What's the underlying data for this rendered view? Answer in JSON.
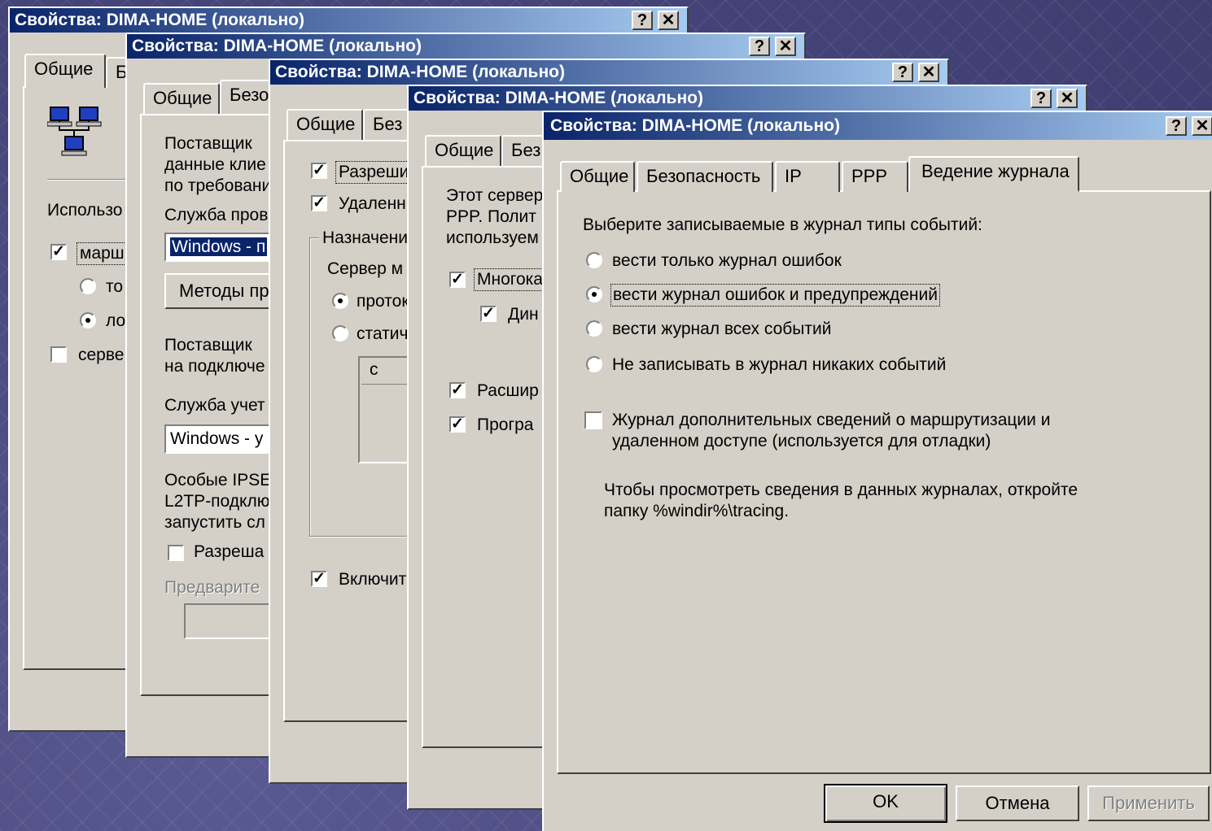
{
  "window_title": "Свойства: DIMA-HOME (локально)",
  "help_glyph": "?",
  "close_glyph": "✕",
  "check_glyph": "✓",
  "win1": {
    "tabs": [
      "Общие",
      "Б"
    ],
    "labels": [
      "Использо",
      "марш",
      "то",
      "ло",
      "серве"
    ]
  },
  "win2": {
    "tabs": [
      "Общие",
      "Безо"
    ],
    "lines": [
      "Поставщик",
      "данные клие",
      "по требовани",
      "Служба пров"
    ],
    "select_value": "Windows - п",
    "methods_button": "Методы пр",
    "lines2": [
      "Поставщик",
      "на подключе"
    ],
    "accounting_label": "Служба учет",
    "accounting_value": "Windows - у",
    "ipsec_lines": [
      "Особые IPSE",
      "L2TP-подклю",
      "запустить сл"
    ],
    "allow_label": "Разреша",
    "preshared_label": "Предварите"
  },
  "win3": {
    "tabs": [
      "Общие",
      "Без"
    ],
    "items": [
      "Разреши",
      "Удаленн"
    ],
    "group_label": "Назначени",
    "server_label": "Сервер м",
    "radio_items": [
      "проток",
      "статич"
    ],
    "list_header": "с",
    "enable_label": "Включит"
  },
  "win4": {
    "tabs": [
      "Общие",
      "Без"
    ],
    "lines": [
      "Этот сервер",
      "PPP. Полит",
      "используем"
    ],
    "items": [
      "Многока",
      "Дин",
      "Расшир",
      "Програ"
    ]
  },
  "win5": {
    "tabs": [
      "Общие",
      "Безопасность",
      "IP",
      "PPP",
      "Ведение журнала"
    ],
    "prompt": "Выберите записываемые в журнал типы событий:",
    "options": [
      "вести только журнал ошибок",
      "вести журнал ошибок и предупреждений",
      "вести журнал всех событий",
      "Не записывать в журнал никаких событий"
    ],
    "selected_option": 1,
    "extra_log_line1": "Журнал дополнительных сведений о маршрутизации и",
    "extra_log_line2": "удаленном доступе (используется для отладки)",
    "info_line1": "Чтобы просмотреть сведения в данных журналах, откройте",
    "info_line2": "папку %windir%\\tracing.",
    "buttons": {
      "ok": "OK",
      "cancel": "Отмена",
      "apply": "Применить"
    }
  }
}
